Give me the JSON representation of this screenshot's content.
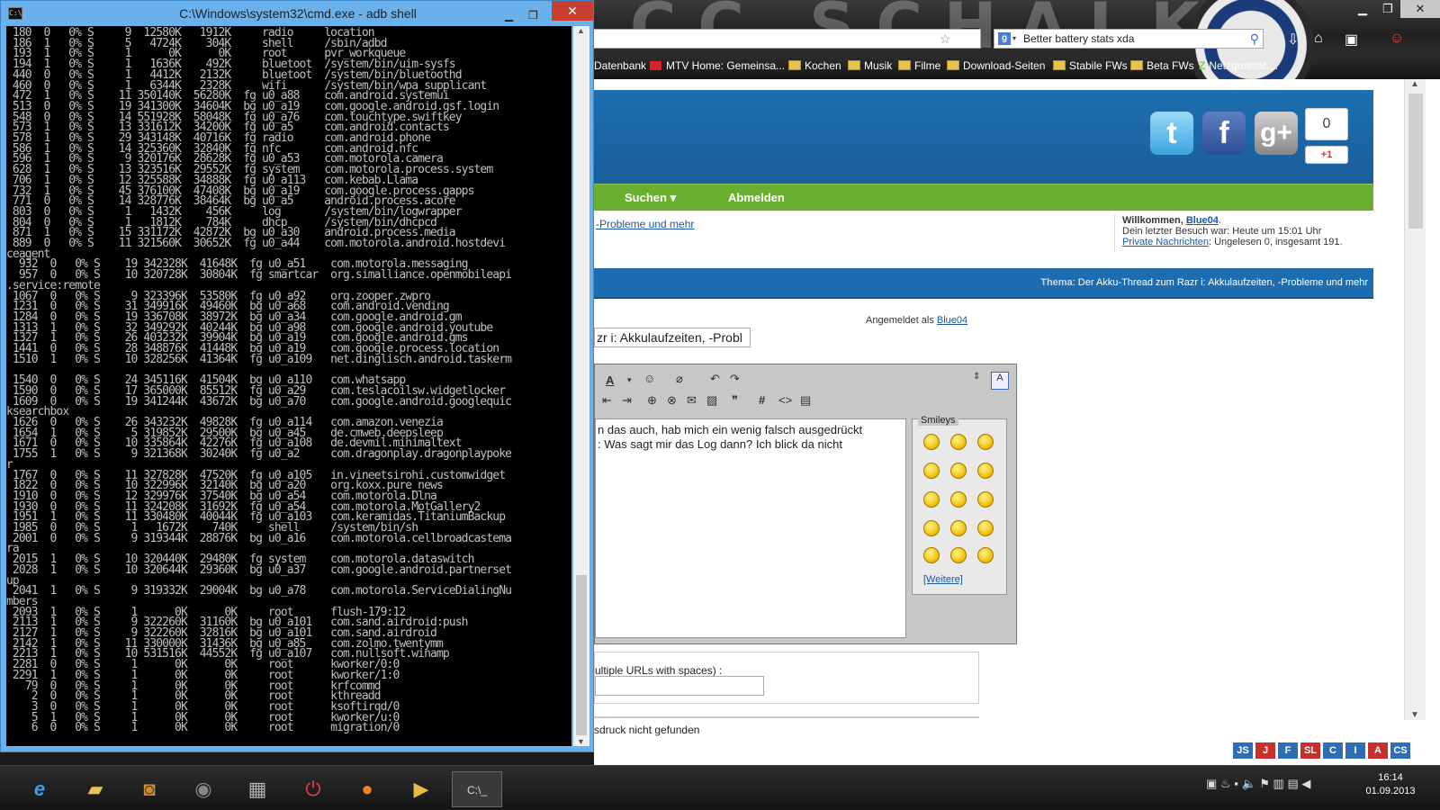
{
  "cmd": {
    "title": "C:\\Windows\\system32\\cmd.exe - adb  shell",
    "lines": [
      " 180  0   0% S     9  12580K   1912K     radio     location",
      " 186  1   0% S     5   4724K    304K     shell     /sbin/adbd",
      " 193  1   0% S     1      0K      0K     root      pvr_workqueue",
      " 194  1   0% S     1   1636K    492K     bluetoot  /system/bin/uim-sysfs",
      " 440  0   0% S     1   4412K   2132K     bluetoot  /system/bin/bluetoothd",
      " 460  0   0% S     1   6344K   2328K     wifi      /system/bin/wpa_supplicant",
      " 472  1   0% S    11 350140K  56280K  fg u0_a88    com.android.systemui",
      " 513  0   0% S    19 341300K  34604K  bg u0_a19    com.google.android.gsf.login",
      " 548  0   0% S    14 551928K  58048K  fg u0_a76    com.touchtype.swiftkey",
      " 573  1   0% S    13 331612K  34200K  fg u0_a5     com.android.contacts",
      " 578  1   0% S    29 343148K  40716K  fg radio     com.android.phone",
      " 586  1   0% S    14 325360K  32840K  fg nfc       com.android.nfc",
      " 596  1   0% S     9 320176K  28628K  fg u0_a53    com.motorola.camera",
      " 628  1   0% S    13 323516K  29552K  fg system    com.motorola.process.system",
      " 706  1   0% S    12 325588K  34888K  fg u0_a113   com.kebab.Llama",
      " 732  1   0% S    45 376100K  47408K  bg u0_a19    com.google.process.gapps",
      " 771  0   0% S    14 328776K  38464K  bg u0_a5     android.process.acore",
      " 803  0   0% S     1   1432K    456K     log       /system/bin/logwrapper",
      " 804  0   0% S     1   1812K    784K     dhcp      /system/bin/dhcpcd",
      " 871  1   0% S    15 331172K  42872K  bg u0_a30    android.process.media",
      " 889  0   0% S    11 321560K  30652K  fg u0_a44    com.motorola.android.hostdevi",
      "ceagent",
      "  932  0   0% S    19 342328K  41648K  fg u0_a51    com.motorola.messaging",
      "  957  0   0% S    10 320728K  30804K  fg smartcar  org.simalliance.openmobileapi",
      ".service:remote",
      " 1067  0   0% S     9 323396K  53580K  fg u0_a92    org.zooper.zwpro",
      " 1231  0   0% S    31 349916K  49460K  bg u0_a68    com.android.vending",
      " 1284  0   0% S    19 336708K  38972K  bg u0_a34    com.google.android.gm",
      " 1313  1   0% S    32 349292K  40244K  bg u0_a98    com.google.android.youtube",
      " 1327  1   0% S    26 403232K  39904K  bg u0_a19    com.google.android.gms",
      " 1441  0   0% S    28 348876K  41448K  bg u0_a19    com.google.process.location",
      " 1510  1   0% S    10 328256K  41364K  fg u0_a109   net.dinglisch.android.taskerm",
      "",
      " 1540  0   0% S    24 345116K  41504K  bg u0_a110   com.whatsapp",
      " 1590  0   0% S    17 365000K  85512K  fg u0_a29    com.teslacoilsw.widgetlocker",
      " 1609  0   0% S    19 341244K  43672K  bg u0_a70    com.google.android.googlequic",
      "ksearchbox",
      " 1626  0   0% S    26 343232K  49828K  fg u0_a114   com.amazon.venezia",
      " 1654  1   0% S     5 319852K  29500K  bg u0_a45    de.cmweb.deepsleep",
      " 1671  0   0% S    10 335864K  42276K  fg u0_a108   de.devmil.minimaltext",
      " 1755  1   0% S     9 321368K  30240K  fg u0_a2     com.dragonplay.dragonplaypoke",
      "r",
      " 1767  0   0% S    11 327828K  47520K  fg u0_a105   in.vineetsirohi.customwidget",
      " 1822  0   0% S    10 322996K  32140K  bg u0_a20    org.koxx.pure_news",
      " 1910  0   0% S    12 329976K  37540K  bg u0_a54    com.motorola.Dlna",
      " 1930  0   0% S    11 324208K  31692K  fg u0_a54    com.motorola.MotGallery2",
      " 1951  1   0% S    11 330480K  40044K  fg u0_a103   com.keramidas.TitaniumBackup",
      " 1985  0   0% S     1   1672K    740K     shell     /system/bin/sh",
      " 2001  0   0% S     9 319344K  28876K  bg u0_a16    com.motorola.cellbroadcastema",
      "ra",
      " 2015  1   0% S    10 320440K  29480K  fg system    com.motorola.dataswitch",
      " 2028  1   0% S    10 320644K  29360K  bg u0_a37    com.google.android.partnerset",
      "up",
      " 2041  1   0% S     9 319332K  29004K  bg u0_a78    com.motorola.ServiceDialingNu",
      "mbers",
      " 2093  1   0% S     1      0K      0K     root      flush-179:12",
      " 2113  1   0% S     9 322260K  31160K  bg u0_a101   com.sand.airdroid:push",
      " 2127  1   0% S     9 322260K  32816K  bg u0_a101   com.sand.airdroid",
      " 2142  1   0% S    11 330000K  31436K  bg u0_a85    com.zolmo.twentymm",
      " 2213  1   0% S    10 531516K  44552K  fg u0_a107   com.nullsoft.winamp",
      " 2281  0   0% S     1      0K      0K     root      kworker/0:0",
      " 2291  1   0% S     1      0K      0K     root      kworker/1:0",
      "   79  0   0% S     1      0K      0K     root      krfcommd",
      "    2  0   0% S     1      0K      0K     root      kthreadd",
      "    3  0   0% S     1      0K      0K     root      ksoftirqd/0",
      "    5  1   0% S     1      0K      0K     root      kworker/u:0",
      "    6  0   0% S     1      0K      0K     root      migration/0"
    ]
  },
  "browser": {
    "search_text": "Better battery stats xda",
    "bookmarks": [
      "Datenbank",
      "MTV Home: Gemeinsa...",
      "Kochen",
      "Musik",
      "Filme",
      "Download-Seiten",
      "Stabile FWs",
      "Beta FWs",
      "Netzqualität:..."
    ],
    "gplus_count": "0",
    "gplus_label": "+1",
    "nav_search": "Suchen ▾",
    "nav_logout": "Abmelden",
    "breadcrumb": "-Probleme und mehr",
    "welcome_prefix": "Willkommen, ",
    "welcome_user": "Blue04",
    "welcome_last": "Dein letzter Besuch war: Heute um 15:01 Uhr",
    "welcome_pm_link": "Private Nachrichten",
    "welcome_pm_rest": ": Ungelesen 0, insgesamt 191.",
    "thema_label": "Thema",
    "thema_title": ": Der Akku-Thread zum Razr i: Akkulaufzeiten, -Probleme und mehr",
    "logged_in_prefix": "Angemeldet als ",
    "logged_in_user": "Blue04",
    "title_field": "zr i: Akkulaufzeiten, -Probl",
    "editor_line1": "n das auch, hab mich ein wenig falsch ausgedrückt",
    "editor_line2": ": Was sagt mir das Log dann? Ich blick da nicht",
    "smileys_label": "Smileys",
    "smileys_more": "[Weitere]",
    "url_label": "ultiple URLs with spaces) :",
    "not_found": "sdruck nicht gefunden"
  },
  "langbar": [
    "JS",
    "J",
    "F",
    "SL",
    "C",
    "I",
    "A",
    "CS"
  ],
  "clock": {
    "time": "16:14",
    "date": "01.09.2013"
  }
}
